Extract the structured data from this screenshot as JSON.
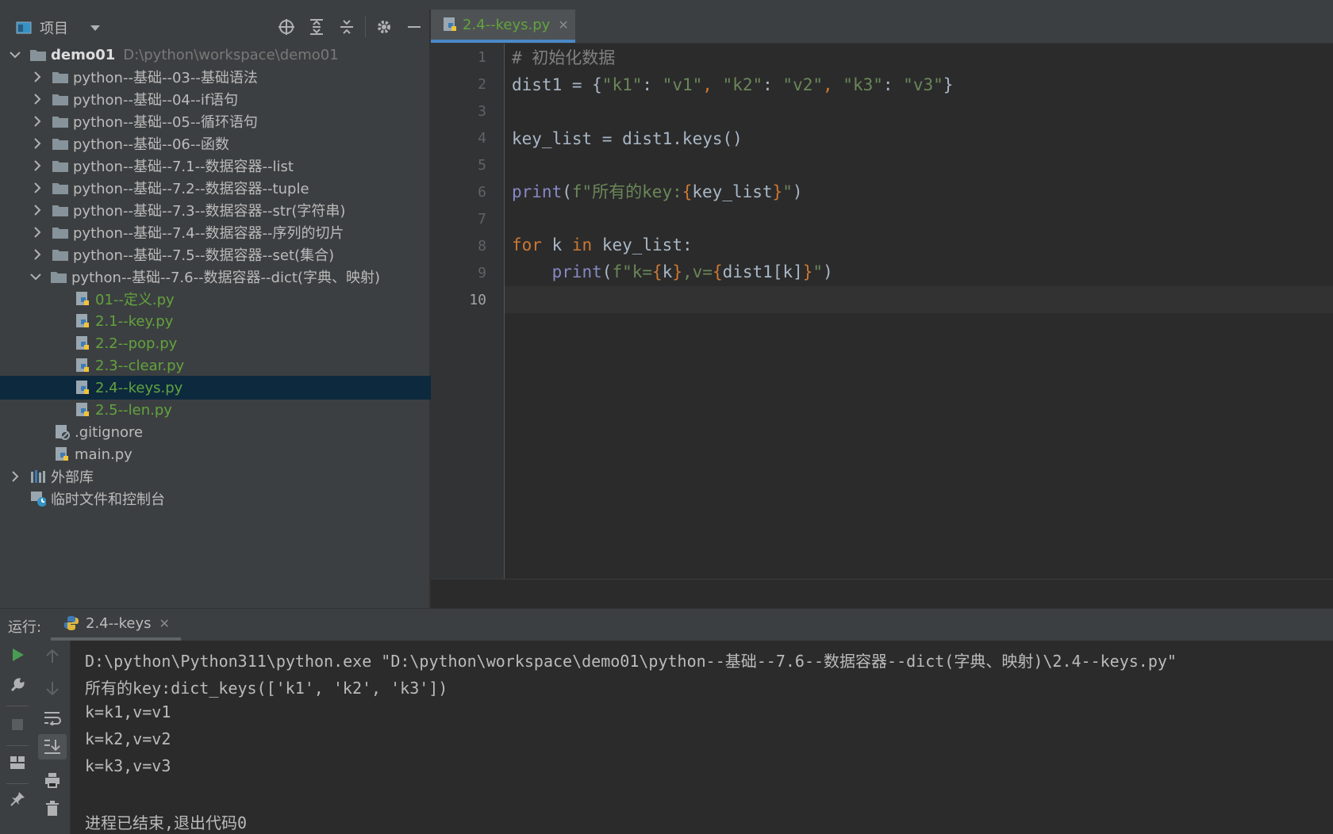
{
  "project_panel": {
    "title": "项目",
    "root": {
      "name": "demo01",
      "path": "D:\\python\\workspace\\demo01"
    },
    "folders": [
      "python--基础--03--基础语法",
      "python--基础--04--if语句",
      "python--基础--05--循环语句",
      "python--基础--06--函数",
      "python--基础--7.1--数据容器--list",
      "python--基础--7.2--数据容器--tuple",
      "python--基础--7.3--数据容器--str(字符串)",
      "python--基础--7.4--数据容器--序列的切片",
      "python--基础--7.5--数据容器--set(集合)",
      "python--基础--7.6--数据容器--dict(字典、映射)"
    ],
    "files": [
      "01--定义.py",
      "2.1--key.py",
      "2.2--pop.py",
      "2.3--clear.py",
      "2.4--keys.py",
      "2.5--len.py"
    ],
    "selected_file": "2.4--keys.py",
    "root_files": [
      ".gitignore",
      "main.py"
    ],
    "external_libs": "外部库",
    "scratches": "临时文件和控制台"
  },
  "editor": {
    "tab_label": "2.4--keys.py",
    "line_numbers": [
      "1",
      "2",
      "3",
      "4",
      "5",
      "6",
      "7",
      "8",
      "9",
      "10"
    ],
    "lines": {
      "l1": "# 初始化数据",
      "l2": {
        "a": "dist1 = {",
        "k1": "\"k1\"",
        "c1": ": ",
        "v1": "\"v1\"",
        "s1": ", ",
        "k2": "\"k2\"",
        "c2": ": ",
        "v2": "\"v2\"",
        "s2": ", ",
        "k3": "\"k3\"",
        "c3": ": ",
        "v3": "\"v3\"",
        "z": "}"
      },
      "l4": "key_list = dist1.keys()",
      "l6": {
        "fn": "print",
        "p": "(",
        "f": "f\"所有的key:",
        "b1": "{",
        "expr": "key_list",
        "b2": "}",
        "q": "\"",
        "e": ")"
      },
      "l8": {
        "kw1": "for",
        "var": " k ",
        "kw2": "in",
        "rest": " key_list:"
      },
      "l9": {
        "indent": "    ",
        "fn": "print",
        "p": "(",
        "f": "f\"k=",
        "b1": "{",
        "e1": "k",
        "b2": "}",
        "m": ",v=",
        "b3": "{",
        "e2": "dist1[k]",
        "b4": "}",
        "q": "\"",
        "e": ")"
      }
    }
  },
  "run_panel": {
    "label": "运行:",
    "tab_label": "2.4--keys",
    "output": [
      "D:\\python\\Python311\\python.exe \"D:\\python\\workspace\\demo01\\python--基础--7.6--数据容器--dict(字典、映射)\\2.4--keys.py\"",
      "所有的key:dict_keys(['k1', 'k2', 'k3'])",
      "k=k1,v=v1",
      "k=k2,v=v2",
      "k=k3,v=v3",
      "",
      "进程已结束,退出代码0"
    ]
  },
  "colors": {
    "background": "#2b2b2b",
    "panel": "#3c3f41",
    "selection": "#0d293e",
    "string": "#6a8759",
    "keyword": "#cc7832",
    "builtin": "#8888c6",
    "comment": "#808080",
    "py_file": "#62a33e"
  },
  "icons": [
    "project-view-icon",
    "dropdown-icon",
    "locate-icon",
    "expand-all-icon",
    "collapse-all-icon",
    "gear-icon",
    "minimize-icon",
    "folder-icon",
    "python-file-icon",
    "gitignore-file-icon",
    "library-icon",
    "scratch-icon",
    "run-icon",
    "wrench-icon",
    "stop-icon",
    "layout-icon",
    "pin-icon",
    "up-arrow-icon",
    "down-arrow-icon",
    "soft-wrap-icon",
    "scroll-end-icon",
    "print-icon",
    "trash-icon"
  ]
}
